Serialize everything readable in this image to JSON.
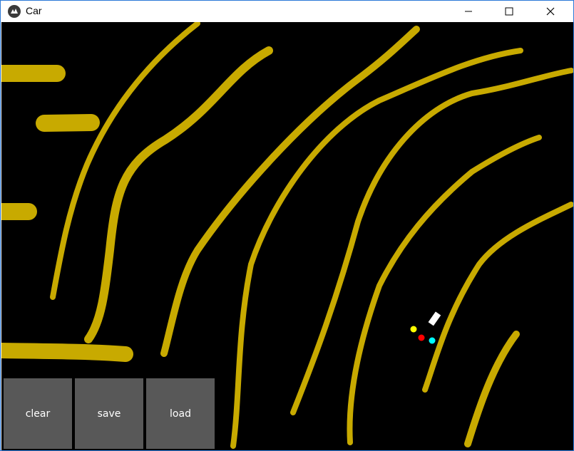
{
  "window": {
    "title": "Car",
    "icon": "kivy-logo-icon",
    "controls": [
      "minimize-icon",
      "maximize-icon",
      "close-icon"
    ]
  },
  "canvas": {
    "background": "#000000",
    "stroke_color": "#c8aa00",
    "car_color": "#ffffff",
    "sensor_colors": [
      "#ffff00",
      "#ff0000",
      "#00ffff"
    ]
  },
  "buttons": {
    "clear": "clear",
    "save": "save",
    "load": "load"
  }
}
